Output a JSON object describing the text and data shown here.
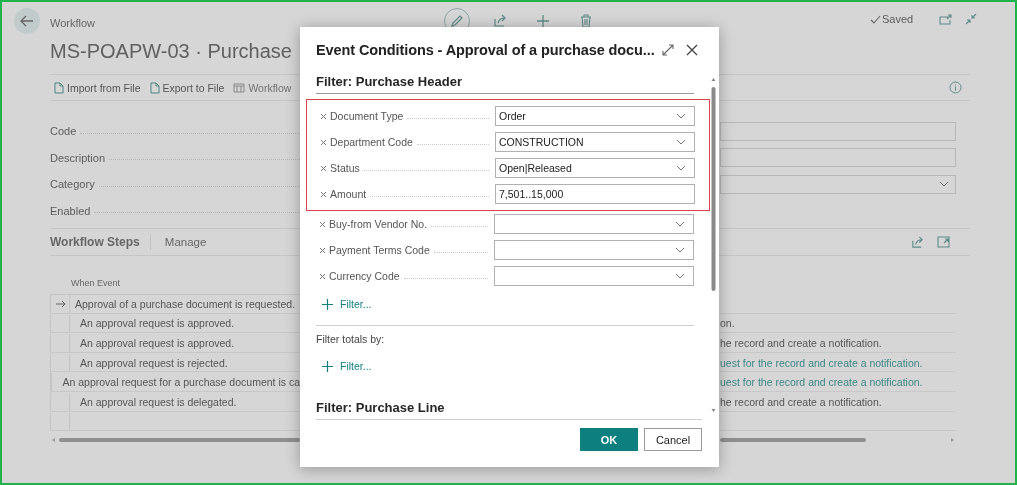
{
  "page": {
    "breadcrumb": "Workflow",
    "title": "MS-POAPW-03 · Purchase",
    "status": "Saved"
  },
  "actions": [
    {
      "label": "Import from File",
      "disabled": false
    },
    {
      "label": "Export to File",
      "disabled": false
    },
    {
      "label": "Workflow",
      "disabled": true
    }
  ],
  "fields": [
    {
      "label": "Code",
      "kind": "text"
    },
    {
      "label": "Description",
      "kind": "text"
    },
    {
      "label": "Category",
      "kind": "dropdown"
    },
    {
      "label": "Enabled",
      "kind": "covered"
    }
  ],
  "steps_tabs": [
    {
      "label": "Workflow Steps",
      "selected": true
    },
    {
      "label": "Manage",
      "selected": false
    }
  ],
  "table": {
    "columns": [
      "When Event"
    ],
    "rows": [
      {
        "event": "Approval of a purchase document is requested.",
        "current": true,
        "children": [
          {
            "event": "An approval request is approved.",
            "current": false,
            "column_2": "on.",
            "link": false
          },
          {
            "event": "An approval request is approved.",
            "current": false,
            "column_2": "he record and create a notification.",
            "link": false
          },
          {
            "event": "An approval request is rejected.",
            "current": false,
            "column_2": "uest for the record and create a notification.",
            "link": true
          },
          {
            "event": "An approval request for a purchase document is ca",
            "current": false,
            "column_2": "uest for the record and create a notification.",
            "link": true
          },
          {
            "event": "An approval request is delegated.",
            "current": false,
            "column_2": "he record and create a notification.",
            "link": false
          }
        ]
      }
    ]
  },
  "dialog": {
    "title": "Event Conditions - Approval of a purchase docu...",
    "header_section": {
      "heading": "Filter: Purchase Header",
      "highlighted_filters": [
        {
          "label": "Document Type",
          "value": "Order",
          "kind": "dropdown"
        },
        {
          "label": "Department Code",
          "value": "CONSTRUCTION",
          "kind": "dropdown"
        },
        {
          "label": "Status",
          "value": "Open|Released",
          "kind": "dropdown"
        },
        {
          "label": "Amount",
          "value": "7,501..15,000",
          "kind": "text"
        }
      ],
      "filters": [
        {
          "label": "Buy-from Vendor No.",
          "kind": "dropdown"
        },
        {
          "label": "Payment Terms Code",
          "kind": "dropdown"
        },
        {
          "label": "Currency Code",
          "kind": "dropdown"
        }
      ],
      "add_filter": "Filter..."
    },
    "totals": {
      "label": "Filter totals by:",
      "add_filter": "Filter..."
    },
    "line_section": {
      "heading": "Filter: Purchase Line"
    },
    "buttons": [
      {
        "label": "OK",
        "kind": "primary"
      },
      {
        "label": "Cancel",
        "kind": "secondary"
      }
    ]
  }
}
